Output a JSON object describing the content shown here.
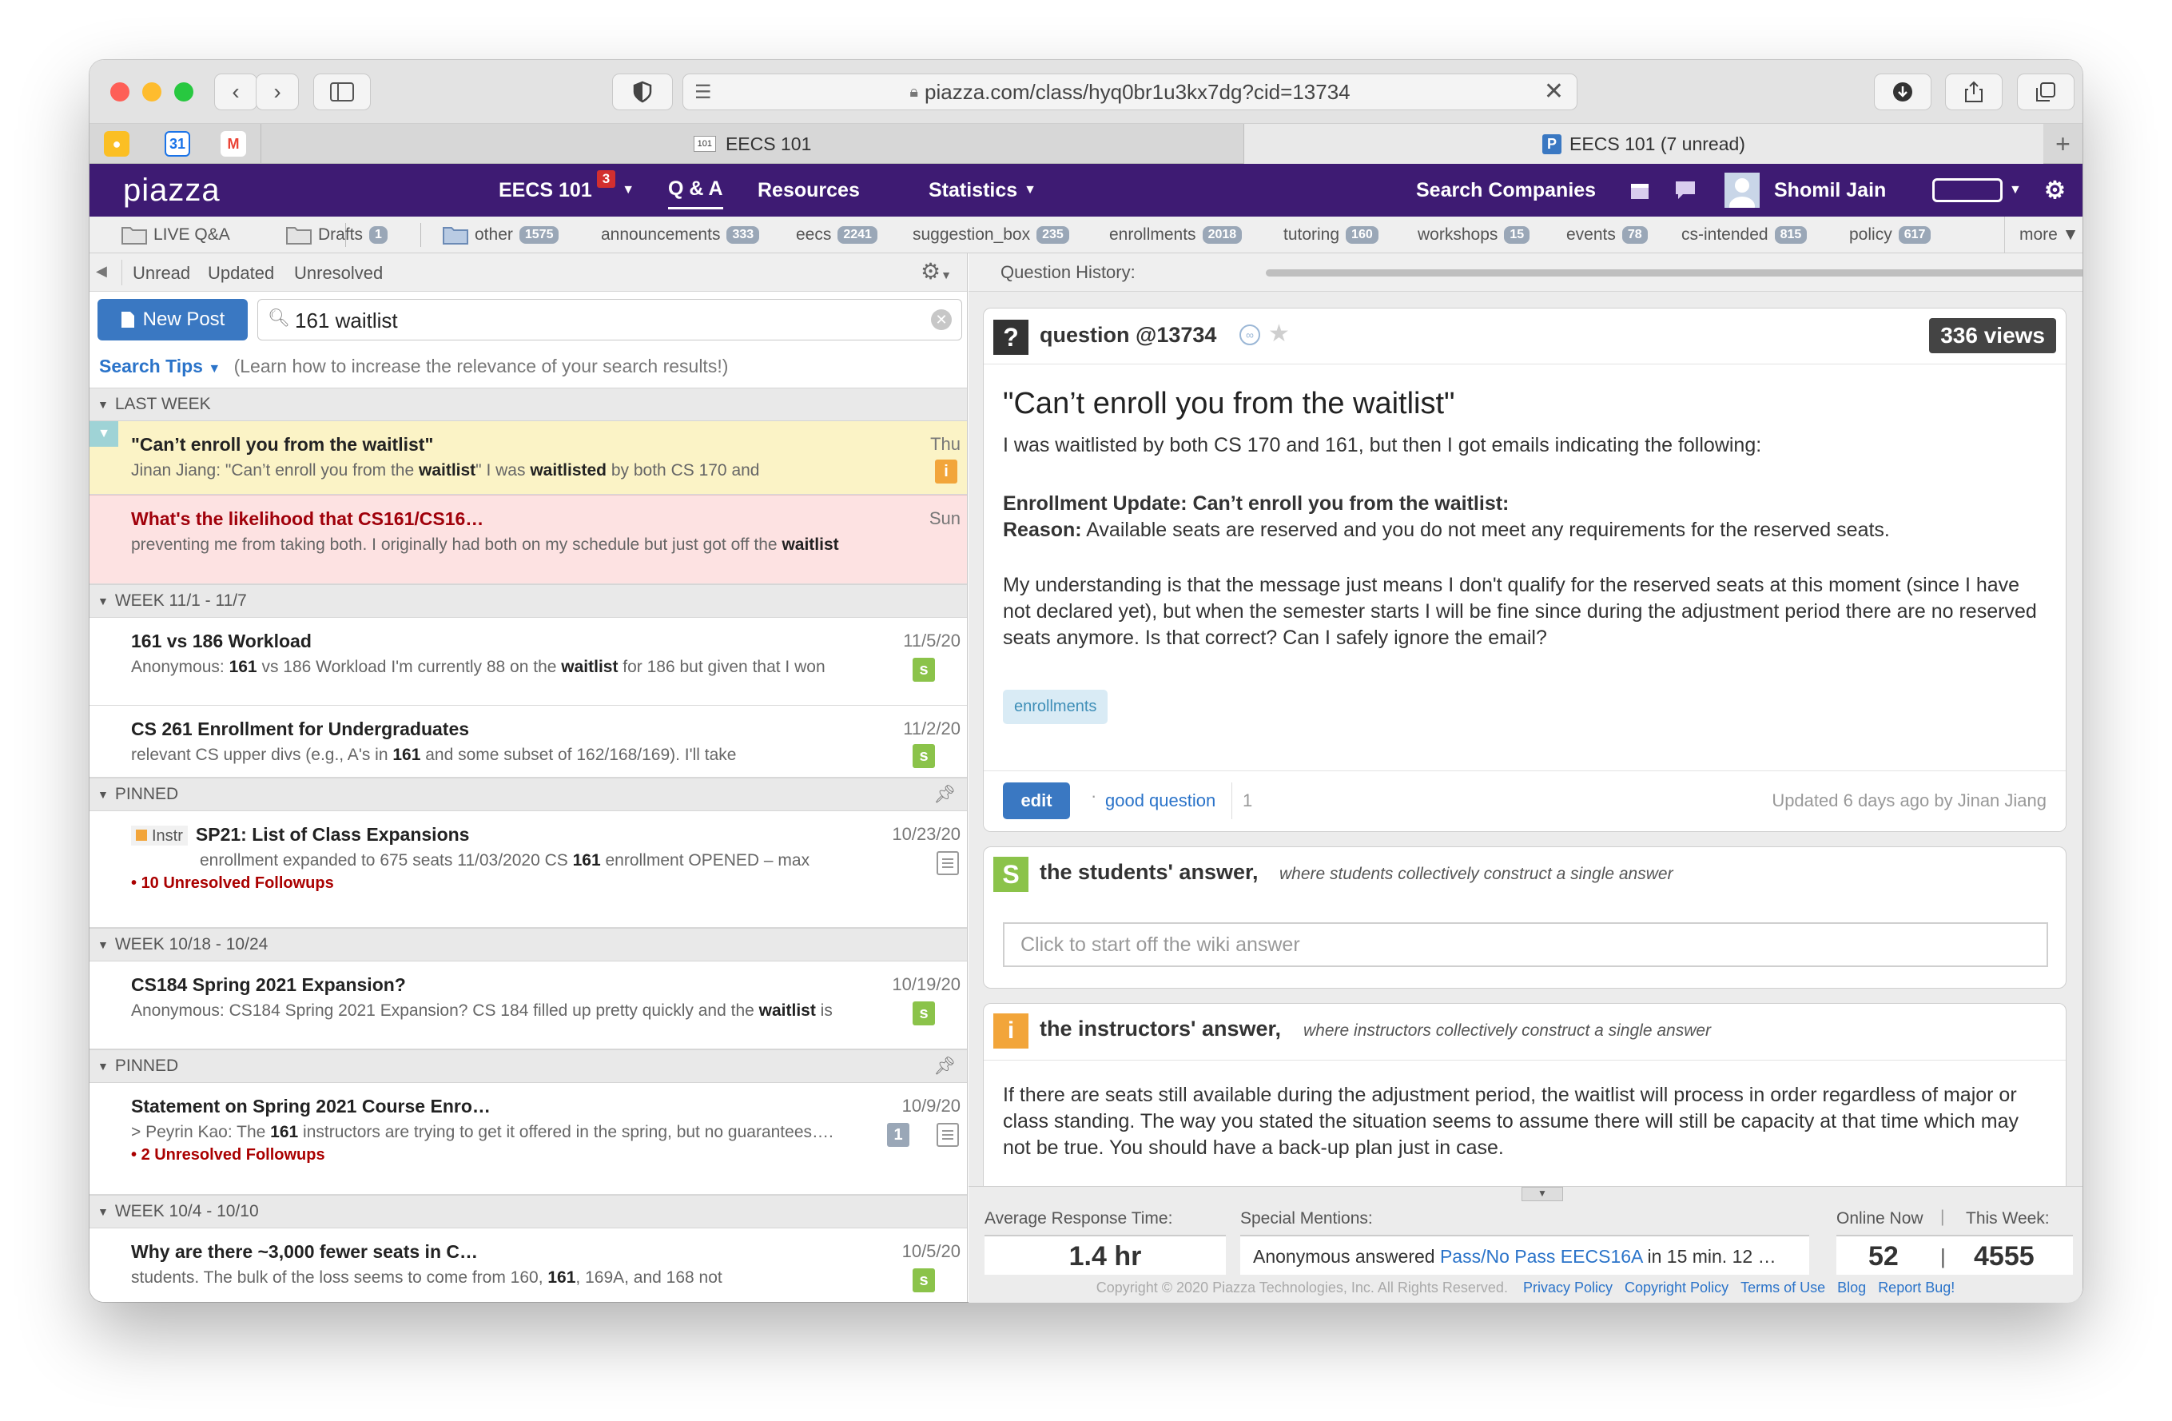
{
  "browser": {
    "url": "piazza.com/class/hyq0br1u3kx7dg?cid=13734",
    "tabs": [
      {
        "favicon_text": "101",
        "title": "EECS 101"
      },
      {
        "favicon_text": "P",
        "title": "EECS 101 (7 unread)"
      }
    ],
    "pinned_favicons": [
      "31",
      "M"
    ]
  },
  "topnav": {
    "logo": "piazza",
    "class_name": "EECS 101",
    "class_badge": "3",
    "qa": "Q & A",
    "resources": "Resources",
    "statistics": "Statistics",
    "search_companies": "Search Companies",
    "user": "Shomil Jain"
  },
  "folders": [
    {
      "name": "LIVE Q&A",
      "count": ""
    },
    {
      "name": "Drafts",
      "count": "1"
    },
    {
      "name": "other",
      "count": "1575"
    },
    {
      "name": "announcements",
      "count": "333"
    },
    {
      "name": "eecs",
      "count": "2241"
    },
    {
      "name": "suggestion_box",
      "count": "235"
    },
    {
      "name": "enrollments",
      "count": "2018"
    },
    {
      "name": "tutoring",
      "count": "160"
    },
    {
      "name": "workshops",
      "count": "15"
    },
    {
      "name": "events",
      "count": "78"
    },
    {
      "name": "cs-intended",
      "count": "815"
    },
    {
      "name": "policy",
      "count": "617"
    }
  ],
  "folders_more": "more ▼",
  "filters": {
    "unread": "Unread",
    "updated": "Updated",
    "unresolved": "Unresolved"
  },
  "new_post": "New Post",
  "search_value": "161 waitlist",
  "search_tips": "Search Tips",
  "search_tips_note": "(Learn how to increase the relevance of your search results!)",
  "sections": [
    {
      "header": "LAST WEEK",
      "posts": [
        {
          "title": "\"Can’t enroll you from the waitlist\"",
          "date": "Thu",
          "snippet_parts": [
            "Jinan Jiang: \"Can’t enroll you from the ",
            "waitlist",
            "\" I was ",
            "waitlisted",
            " by both CS 170 and"
          ],
          "badge": "i",
          "style": "selected"
        },
        {
          "title": "What's the likelihood that CS161/CS16…",
          "date": "Sun",
          "snippet_parts": [
            "preventing me from taking both. I originally had both on my schedule but just got off the ",
            "waitlist"
          ],
          "badge": "",
          "style": "unanswered"
        }
      ]
    },
    {
      "header": "WEEK 11/1 - 11/7",
      "posts": [
        {
          "title": "161 vs 186 Workload",
          "date": "11/5/20",
          "snippet_parts": [
            "Anonymous: ",
            "161",
            " vs 186 Workload I'm currently 88 on the ",
            "waitlist",
            " for 186 but given that I won"
          ],
          "badge": "s"
        },
        {
          "title": "CS 261 Enrollment for Undergraduates",
          "date": "11/2/20",
          "snippet_parts": [
            "relevant CS upper divs (e.g., A's in ",
            "161",
            " and some subset of 162/168/169). I'll take"
          ],
          "badge": "s"
        }
      ]
    },
    {
      "header": "PINNED",
      "posts": [
        {
          "instr": "Instr",
          "title": "SP21: List of Class Expansions",
          "date": "10/23/20",
          "snippet_parts": [
            "enrollment expanded to 675 seats 11/03/2020          CS ",
            "161",
            " enrollment OPENED – max"
          ],
          "unresolved": "10 Unresolved Followups",
          "badge": "note"
        }
      ]
    },
    {
      "header": "WEEK 10/18 - 10/24",
      "posts": [
        {
          "title": "CS184 Spring 2021 Expansion?",
          "date": "10/19/20",
          "snippet_parts": [
            "Anonymous: CS184 Spring 2021 Expansion? CS 184 filled up pretty quickly and the ",
            "waitlist",
            " is"
          ],
          "badge": "s"
        }
      ]
    },
    {
      "header": "PINNED",
      "posts": [
        {
          "title": "Statement on Spring 2021 Course Enro…",
          "date": "10/9/20",
          "snippet_parts": [
            "> Peyrin Kao: The ",
            "161",
            " instructors are trying to get it offered in the spring, but no guarantees…."
          ],
          "unresolved": "2 Unresolved Followups",
          "badge": "note",
          "count": "1"
        }
      ]
    },
    {
      "header": "WEEK 10/4 - 10/10",
      "posts": [
        {
          "title": "Why are there ~3,000 fewer seats in C…",
          "date": "10/5/20",
          "snippet_parts": [
            "students. The bulk of the loss seems to come from 160, ",
            "161",
            ", 169A, and 168 not"
          ],
          "badge": "s"
        }
      ]
    }
  ],
  "question_history": "Question History:",
  "question": {
    "label": "question @13734",
    "views": "336 views",
    "title": "\"Can’t enroll you from the waitlist\"",
    "p1": "I was waitlisted by both CS 170 and 161, but then I got emails indicating the following:",
    "update_bold": "Enrollment Update: Can’t enroll you from the waitlist:",
    "reason_label": "Reason:",
    "reason_text": " Available seats are reserved and you do not meet any requirements for the reserved seats.",
    "p3": "My understanding is that the message just means I don't qualify for the reserved seats at this moment (since I have not declared yet), but when the semester starts I will be fine since during the adjustment period there are no reserved seats anymore. Is that correct? Can I safely ignore the email?",
    "tag": "enrollments",
    "edit": "edit",
    "good_question": "good question",
    "good_count": "1",
    "updated": "Updated 6 days ago by Jinan Jiang"
  },
  "students_answer": {
    "title": "the students' answer,",
    "subtitle": "where students collectively construct a single answer",
    "placeholder": "Click to start off the wiki answer"
  },
  "instructors_answer": {
    "title": "the instructors' answer,",
    "subtitle": "where instructors collectively construct a single answer",
    "body": "If there are seats still available during the adjustment period, the waitlist will process in order regardless of major or class standing. The way you stated the situation seems to assume there will still be capacity at that time which may not be true. You should have a back-up plan just in case."
  },
  "stats": {
    "avg_label": "Average Response Time:",
    "avg_value": "1.4 hr",
    "mentions_label": "Special Mentions:",
    "mentions_pre": "Anonymous answered ",
    "mentions_link": "Pass/No Pass EECS16A",
    "mentions_post": " in 15 min. 12 …",
    "online_label": "Online Now",
    "week_label": "This Week:",
    "online_value": "52",
    "week_value": "4555"
  },
  "copyright": "Copyright © 2020 Piazza Technologies, Inc. All Rights Reserved.",
  "footer_links": [
    "Privacy Policy",
    "Copyright Policy",
    "Terms of Use",
    "Blog",
    "Report Bug!"
  ],
  "colors": {
    "purple": "#3e1b73",
    "student_green": "#8bc34a",
    "instructor_orange": "#f2a53a",
    "selected": "#fbf3c6",
    "unanswered": "#fde2e2"
  }
}
